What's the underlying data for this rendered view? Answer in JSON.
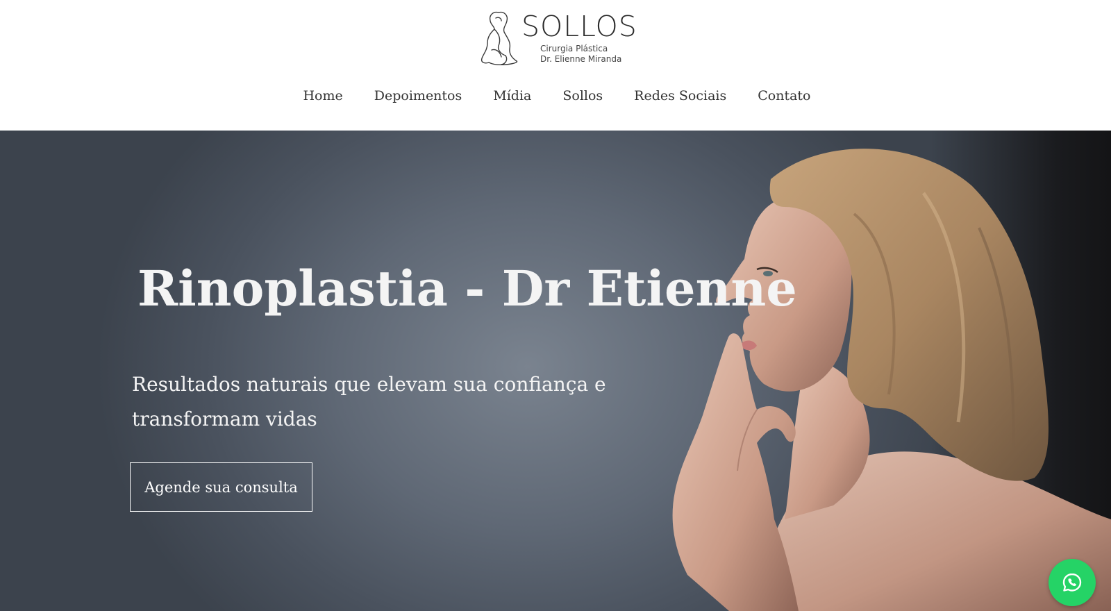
{
  "brand": {
    "wordmark": "SOLLOS",
    "subtitle_line1": "Cirurgia Plástica",
    "subtitle_line2": "Dr. Elienne Miranda"
  },
  "nav": {
    "items": [
      {
        "label": "Home"
      },
      {
        "label": "Depoimentos"
      },
      {
        "label": "Mídia"
      },
      {
        "label": "Sollos"
      },
      {
        "label": "Redes Sociais"
      },
      {
        "label": "Contato"
      }
    ]
  },
  "hero": {
    "title": "Rinoplastia - Dr Etienne",
    "subtitle": "Resultados naturais que elevam sua confiança e transformam vidas",
    "cta_label": "Agende sua consulta"
  },
  "floating": {
    "whatsapp_icon": "whatsapp-icon"
  },
  "colors": {
    "hero_overlay": "#5f6875",
    "text_light": "#f4f4f4",
    "nav_text": "#333333",
    "whatsapp": "#25d366"
  }
}
